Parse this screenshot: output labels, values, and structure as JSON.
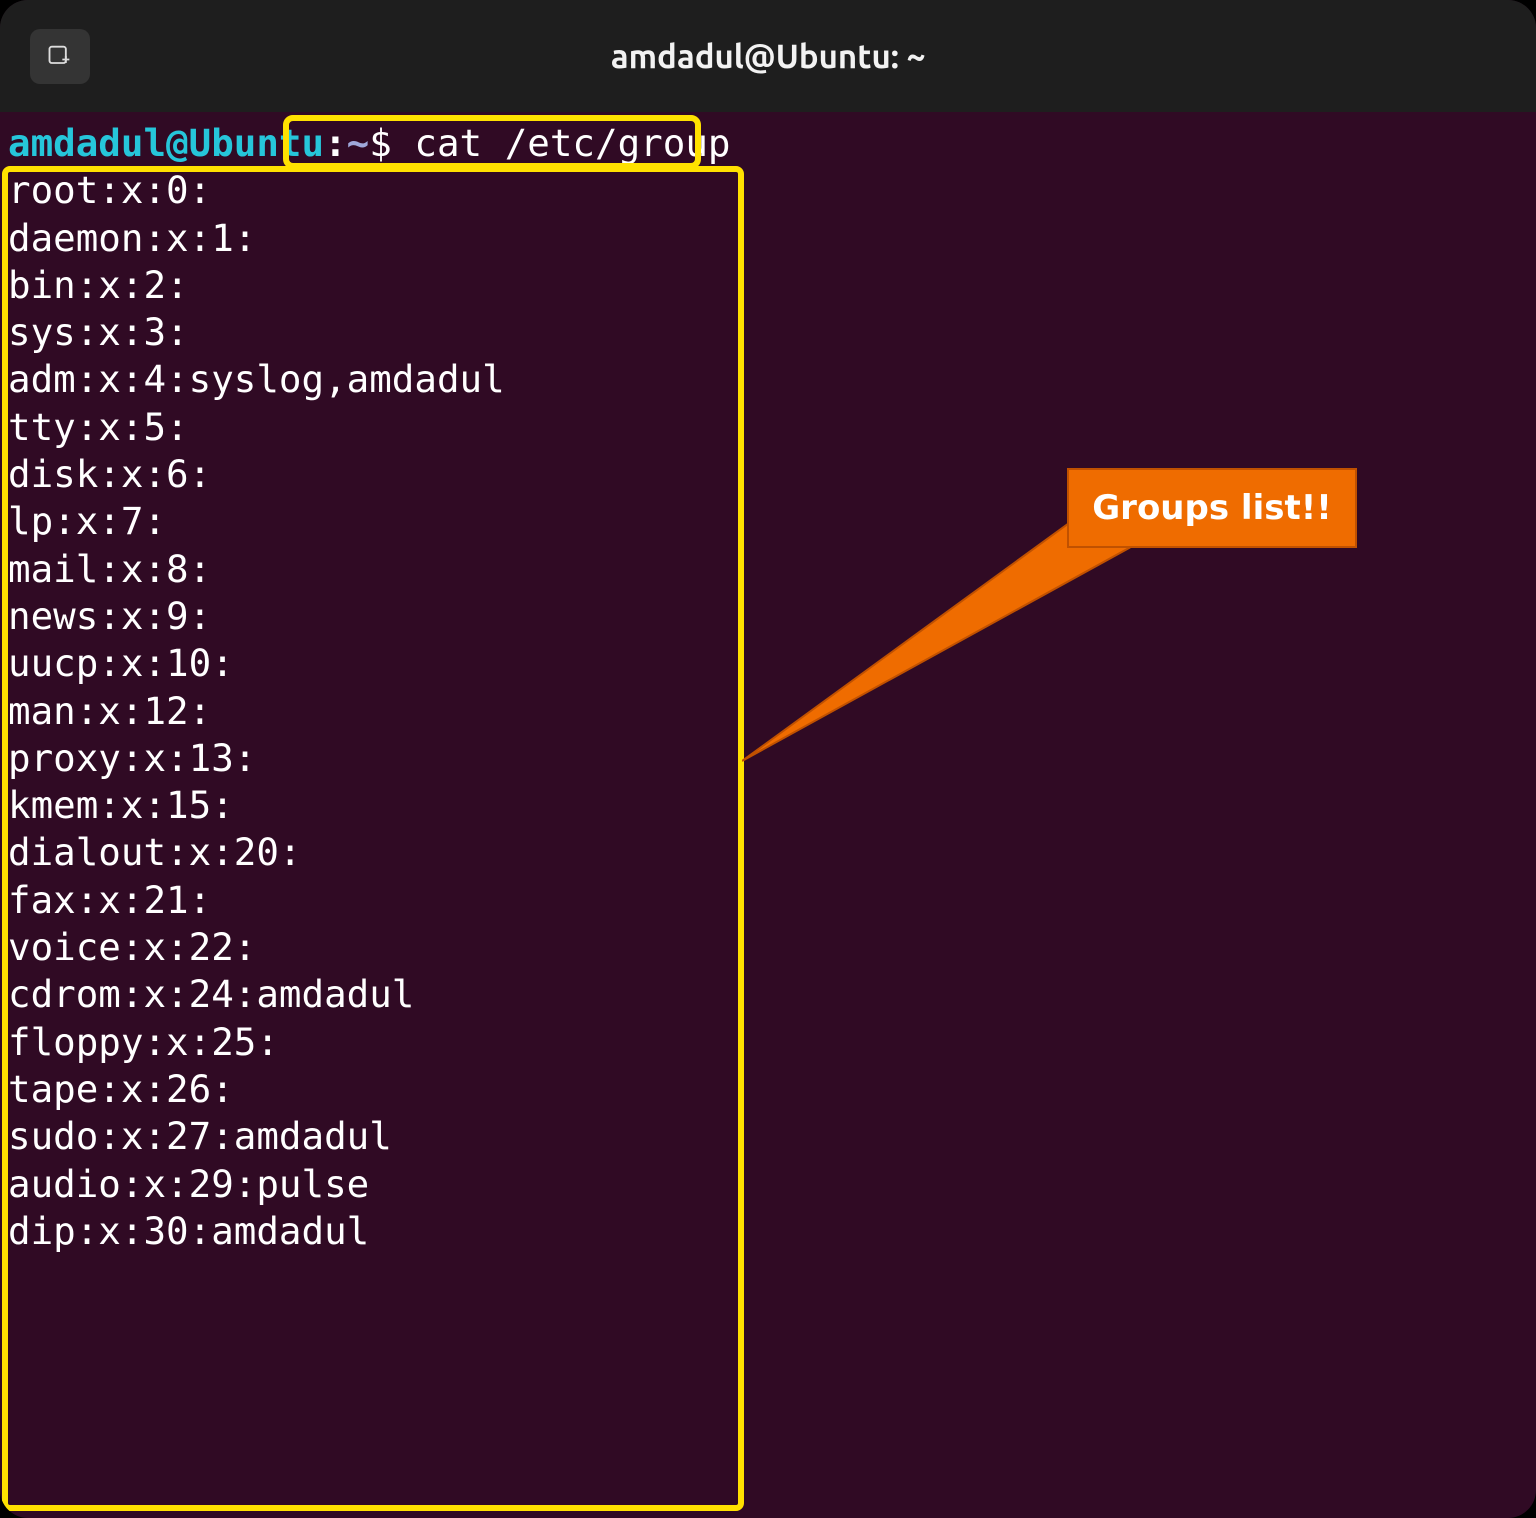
{
  "window": {
    "title": "amdadul@Ubuntu: ~"
  },
  "prompt": {
    "user_host": "amdadul@Ubuntu",
    "colon": ":",
    "path": "~",
    "dollar": "$"
  },
  "command": "cat /etc/group",
  "output_lines": [
    "root:x:0:",
    "daemon:x:1:",
    "bin:x:2:",
    "sys:x:3:",
    "adm:x:4:syslog,amdadul",
    "tty:x:5:",
    "disk:x:6:",
    "lp:x:7:",
    "mail:x:8:",
    "news:x:9:",
    "uucp:x:10:",
    "man:x:12:",
    "proxy:x:13:",
    "kmem:x:15:",
    "dialout:x:20:",
    "fax:x:21:",
    "voice:x:22:",
    "cdrom:x:24:amdadul",
    "floppy:x:25:",
    "tape:x:26:",
    "sudo:x:27:amdadul",
    "audio:x:29:pulse",
    "dip:x:30:amdadul"
  ],
  "callout": {
    "label": "Groups list!!"
  },
  "icons": {
    "new_tab": "new-tab-icon"
  },
  "colors": {
    "background": "#300a24",
    "titlebar": "#1e1e1e",
    "highlight": "#ffe100",
    "callout": "#ef6c00",
    "prompt_user": "#26c6da",
    "prompt_path": "#9fa8da"
  }
}
